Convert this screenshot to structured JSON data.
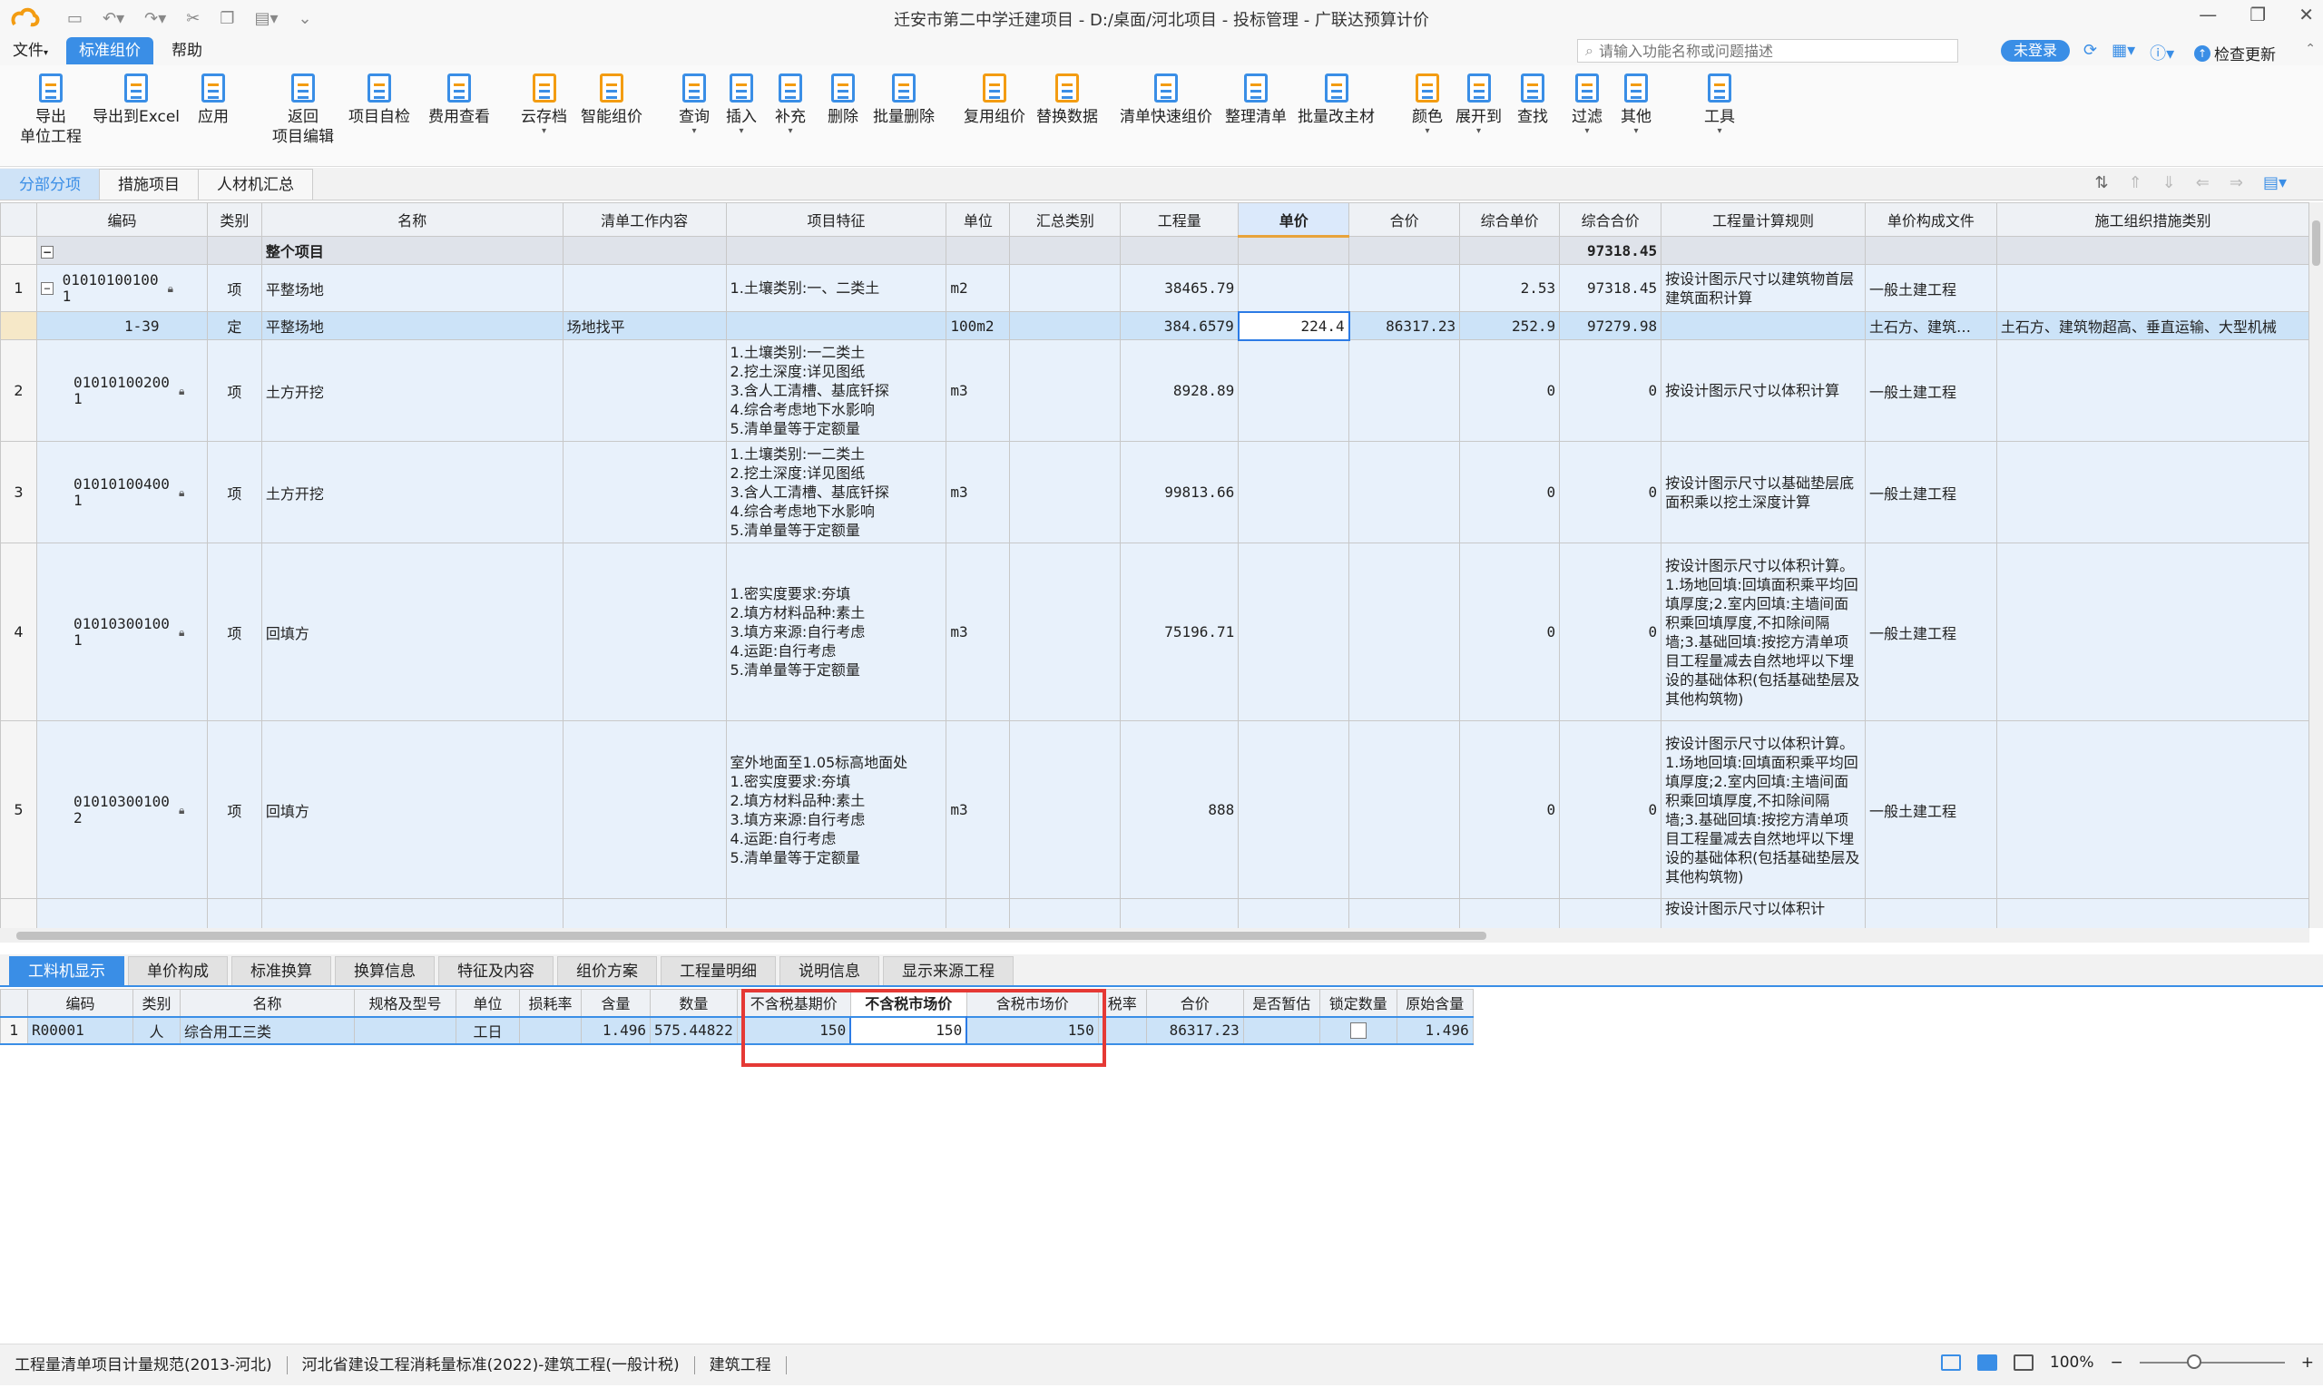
{
  "window": {
    "title": "迁安市第二中学迁建项目 - D:/桌面/河北项目 - 投标管理 - 广联达预算计价"
  },
  "menu": {
    "file": "文件",
    "standard": "标准组价",
    "help": "帮助",
    "search_placeholder": "请输入功能名称或问题描述",
    "login": "未登录",
    "check_update": "检查更新"
  },
  "toolbar": [
    {
      "label": "导出\n单位工程",
      "icon": "export-icon"
    },
    {
      "label": "导出到Excel",
      "icon": "excel-export-icon"
    },
    {
      "label": "应用",
      "icon": "apply-icon"
    },
    {
      "label": "返回\n项目编辑",
      "icon": "return-icon"
    },
    {
      "label": "项目自检",
      "icon": "self-check-icon"
    },
    {
      "label": "费用查看",
      "icon": "fee-view-icon"
    },
    {
      "label": "云存档",
      "icon": "cloud-save-icon"
    },
    {
      "label": "智能组价",
      "icon": "smart-price-icon"
    },
    {
      "label": "查询",
      "icon": "query-icon"
    },
    {
      "label": "插入",
      "icon": "insert-icon"
    },
    {
      "label": "补充",
      "icon": "supplement-icon"
    },
    {
      "label": "删除",
      "icon": "delete-icon"
    },
    {
      "label": "批量删除",
      "icon": "batch-delete-icon"
    },
    {
      "label": "复用组价",
      "icon": "reuse-price-icon"
    },
    {
      "label": "替换数据",
      "icon": "replace-data-icon"
    },
    {
      "label": "清单快速组价",
      "icon": "quick-price-icon"
    },
    {
      "label": "整理清单",
      "icon": "organize-list-icon"
    },
    {
      "label": "批量改主材",
      "icon": "batch-material-icon"
    },
    {
      "label": "颜色",
      "icon": "color-icon"
    },
    {
      "label": "展开到",
      "icon": "expand-icon"
    },
    {
      "label": "查找",
      "icon": "find-icon"
    },
    {
      "label": "过滤",
      "icon": "filter-icon"
    },
    {
      "label": "其他",
      "icon": "other-icon"
    },
    {
      "label": "工具",
      "icon": "tools-icon"
    }
  ],
  "tabs_top": [
    "分部分项",
    "措施项目",
    "人材机汇总"
  ],
  "main_headers": [
    "编码",
    "类别",
    "名称",
    "清单工作内容",
    "项目特征",
    "单位",
    "汇总类别",
    "工程量",
    "单价",
    "合价",
    "综合单价",
    "综合合价",
    "工程量计算规则",
    "单价构成文件",
    "施工组织措施类别"
  ],
  "whole": {
    "tree": "−",
    "name": "整个项目",
    "total": "97318.45"
  },
  "rows": [
    {
      "no": "1",
      "code": "010101001001",
      "type": "项",
      "name": "平整场地",
      "work": "",
      "feature": "1.土壤类别:一、二类土",
      "unit": "m2",
      "qty": "38465.79",
      "price": "",
      "amount": "",
      "uprice": "2.53",
      "utotal": "97318.45",
      "rule": "按设计图示尺寸以建筑物首层建筑面积计算",
      "file": "一般土建工程",
      "measure": ""
    },
    {
      "no": "",
      "code": "1-39",
      "type": "定",
      "name": "平整场地",
      "work": "场地找平",
      "feature": "",
      "unit": "100m2",
      "qty": "384.6579",
      "price": "224.4",
      "amount": "86317.23",
      "uprice": "252.9",
      "utotal": "97279.98",
      "rule": "",
      "file": "土石方、建筑…",
      "measure": "土石方、建筑物超高、垂直运输、大型机械"
    },
    {
      "no": "2",
      "code": "010101002001",
      "type": "项",
      "name": "土方开挖",
      "work": "",
      "feature": "1.土壤类别:一二类土\n2.挖土深度:详见图纸\n3.含人工清槽、基底钎探\n4.综合考虑地下水影响\n5.清单量等于定额量",
      "unit": "m3",
      "qty": "8928.89",
      "price": "",
      "amount": "",
      "uprice": "0",
      "utotal": "0",
      "rule": "按设计图示尺寸以体积计算",
      "file": "一般土建工程",
      "measure": ""
    },
    {
      "no": "3",
      "code": "010101004001",
      "type": "项",
      "name": "土方开挖",
      "work": "",
      "feature": "1.土壤类别:一二类土\n2.挖土深度:详见图纸\n3.含人工清槽、基底钎探\n4.综合考虑地下水影响\n5.清单量等于定额量",
      "unit": "m3",
      "qty": "99813.66",
      "price": "",
      "amount": "",
      "uprice": "0",
      "utotal": "0",
      "rule": "按设计图示尺寸以基础垫层底面积乘以挖土深度计算",
      "file": "一般土建工程",
      "measure": ""
    },
    {
      "no": "4",
      "code": "010103001001",
      "type": "项",
      "name": "回填方",
      "work": "",
      "feature": "1.密实度要求:夯填\n2.填方材料品种:素土\n3.填方来源:自行考虑\n4.运距:自行考虑\n5.清单量等于定额量",
      "unit": "m3",
      "qty": "75196.71",
      "price": "",
      "amount": "",
      "uprice": "0",
      "utotal": "0",
      "rule": "按设计图示尺寸以体积计算。1.场地回填:回填面积乘平均回填厚度;2.室内回填:主墙间面积乘回填厚度,不扣除间隔墙;3.基础回填:按挖方清单项目工程量减去自然地坪以下埋设的基础体积(包括基础垫层及其他构筑物)",
      "file": "一般土建工程",
      "measure": ""
    },
    {
      "no": "5",
      "code": "010103001002",
      "type": "项",
      "name": "回填方",
      "work": "",
      "feature": "室外地面至1.05标高地面处\n1.密实度要求:夯填\n2.填方材料品种:素土\n3.填方来源:自行考虑\n4.运距:自行考虑\n5.清单量等于定额量",
      "unit": "m3",
      "qty": "888",
      "price": "",
      "amount": "",
      "uprice": "0",
      "utotal": "0",
      "rule": "按设计图示尺寸以体积计算。1.场地回填:回填面积乘平均回填厚度;2.室内回填:主墙间面积乘回填厚度,不扣除间隔墙;3.基础回填:按挖方清单项目工程量减去自然地坪以下埋设的基础体积(包括基础垫层及其他构筑物)",
      "file": "一般土建工程",
      "measure": ""
    }
  ],
  "partial_rule": "按设计图示尺寸以体积计",
  "tabs_bottom": [
    "工料机显示",
    "单价构成",
    "标准换算",
    "换算信息",
    "特征及内容",
    "组价方案",
    "工程量明细",
    "说明信息",
    "显示来源工程"
  ],
  "sub_headers": [
    "编码",
    "类别",
    "名称",
    "规格及型号",
    "单位",
    "损耗率",
    "含量",
    "数量",
    "不含税基期价",
    "不含税市场价",
    "含税市场价",
    "税率",
    "合价",
    "是否暂估",
    "锁定数量",
    "原始含量"
  ],
  "sub_rows": [
    {
      "no": "1",
      "code": "R00001",
      "type": "人",
      "name": "综合用工三类",
      "spec": "",
      "unit": "工日",
      "loss": "",
      "content": "1.496",
      "qty": "575.44822",
      "base": "150",
      "market": "150",
      "taxed": "150",
      "tax": "",
      "total": "86317.23",
      "est": "",
      "orig": "1.496"
    }
  ],
  "status": {
    "spec1": "工程量清单项目计量规范(2013-河北)",
    "spec2": "河北省建设工程消耗量标准(2022)-建筑工程(一般计税)",
    "spec3": "建筑工程",
    "zoom": "100%",
    "zoom_level": 0.36
  }
}
